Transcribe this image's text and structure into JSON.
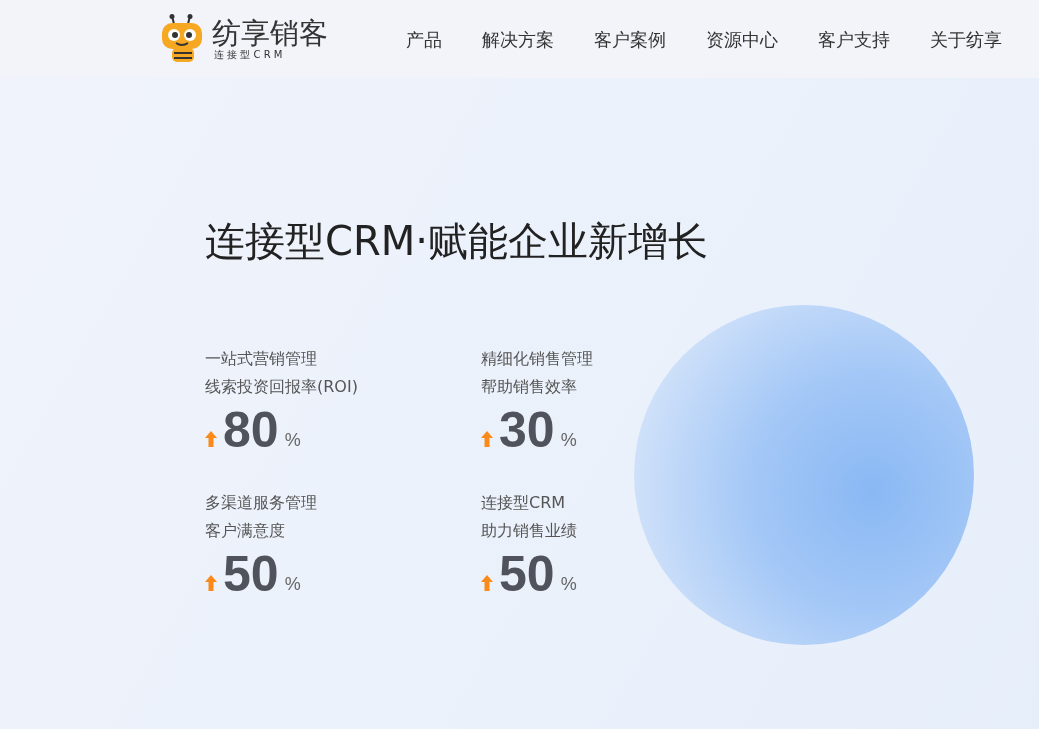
{
  "header": {
    "logo": {
      "name": "纺享销客",
      "tagline": "连 接 型 C R M"
    },
    "nav": [
      "产品",
      "解决方案",
      "客户案例",
      "资源中心",
      "客户支持",
      "关于纺享"
    ]
  },
  "hero": {
    "title": "连接型CRM·赋能企业新增长",
    "stats": [
      {
        "line_1": "一站式营销管理",
        "line_2": "线索投资回报率(ROI)",
        "value": "80",
        "unit": "%"
      },
      {
        "line_1": "精细化销售管理",
        "line_2": "帮助销售效率",
        "value": "30",
        "unit": "%"
      },
      {
        "line_1": "多渠道服务管理",
        "line_2": "客户满意度",
        "value": "50",
        "unit": "%"
      },
      {
        "line_1": "连接型CRM",
        "line_2": "助力销售业绩",
        "value": "50",
        "unit": "%"
      }
    ]
  }
}
